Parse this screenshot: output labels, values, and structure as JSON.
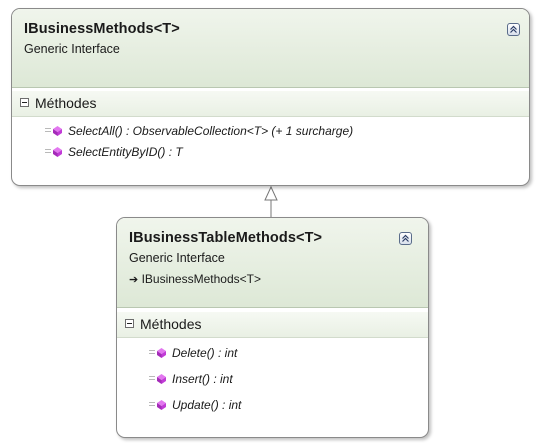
{
  "diagram": {
    "interface_1": {
      "name": "IBusinessMethods<T>",
      "stereotype": "Generic Interface",
      "section_label": "Méthodes",
      "methods": [
        "SelectAll() : ObservableCollection<T> (+ 1 surcharge)",
        "SelectEntityByID() : T"
      ]
    },
    "interface_2": {
      "name": "IBusinessTableMethods<T>",
      "stereotype": "Generic Interface",
      "inherits": "IBusinessMethods<T>",
      "section_label": "Méthodes",
      "methods": [
        "Delete() : int",
        "Insert() : int",
        "Update() : int"
      ]
    },
    "relation": "inheritance",
    "colors": {
      "header_gradient_top": "#f0f5ec",
      "header_gradient_bottom": "#dde8d6",
      "border": "#8a8a8a",
      "method_icon": "#c13bd6"
    },
    "icons": {
      "collapse": "double-chevron-up-icon",
      "method": "method-icon",
      "inherit_arrow": "inherit-arrow-icon",
      "section_toggle": "minus-toggle-icon"
    }
  }
}
